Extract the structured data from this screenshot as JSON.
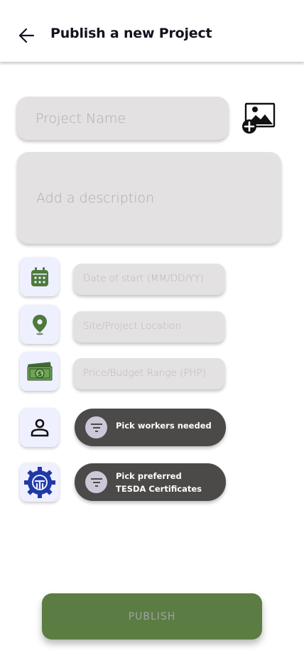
{
  "header": {
    "title": "Publish a new Project",
    "back_icon": "arrow-left-icon"
  },
  "form": {
    "project_name_placeholder": "Project Name",
    "description_placeholder": "Add a description",
    "add_image_icon": "add-image-icon",
    "date_placeholder": "Date of start (MM/DD/YY)",
    "location_placeholder": "Site/Project Location",
    "budget_placeholder": "Price/Budget Range (PHP)",
    "workers_button": {
      "label": "Pick workers needed"
    },
    "certificates_button": {
      "label_line1": "Pick preferred",
      "label_line2": "TESDA Certificates"
    },
    "publish_label": "PUBLISH"
  },
  "icons": {
    "date": "calendar-icon",
    "location": "location-pin-icon",
    "budget": "money-icon",
    "workers": "person-icon",
    "certificates": "tesda-gear-icon",
    "filter": "filter-icon"
  },
  "colors": {
    "accent_green": "#5b7d43",
    "field_bg": "#e3e1e2",
    "pill_bg": "#4b4a49",
    "tile_bg": "#eef0ff",
    "tesda_blue": "#1f3aa6"
  }
}
